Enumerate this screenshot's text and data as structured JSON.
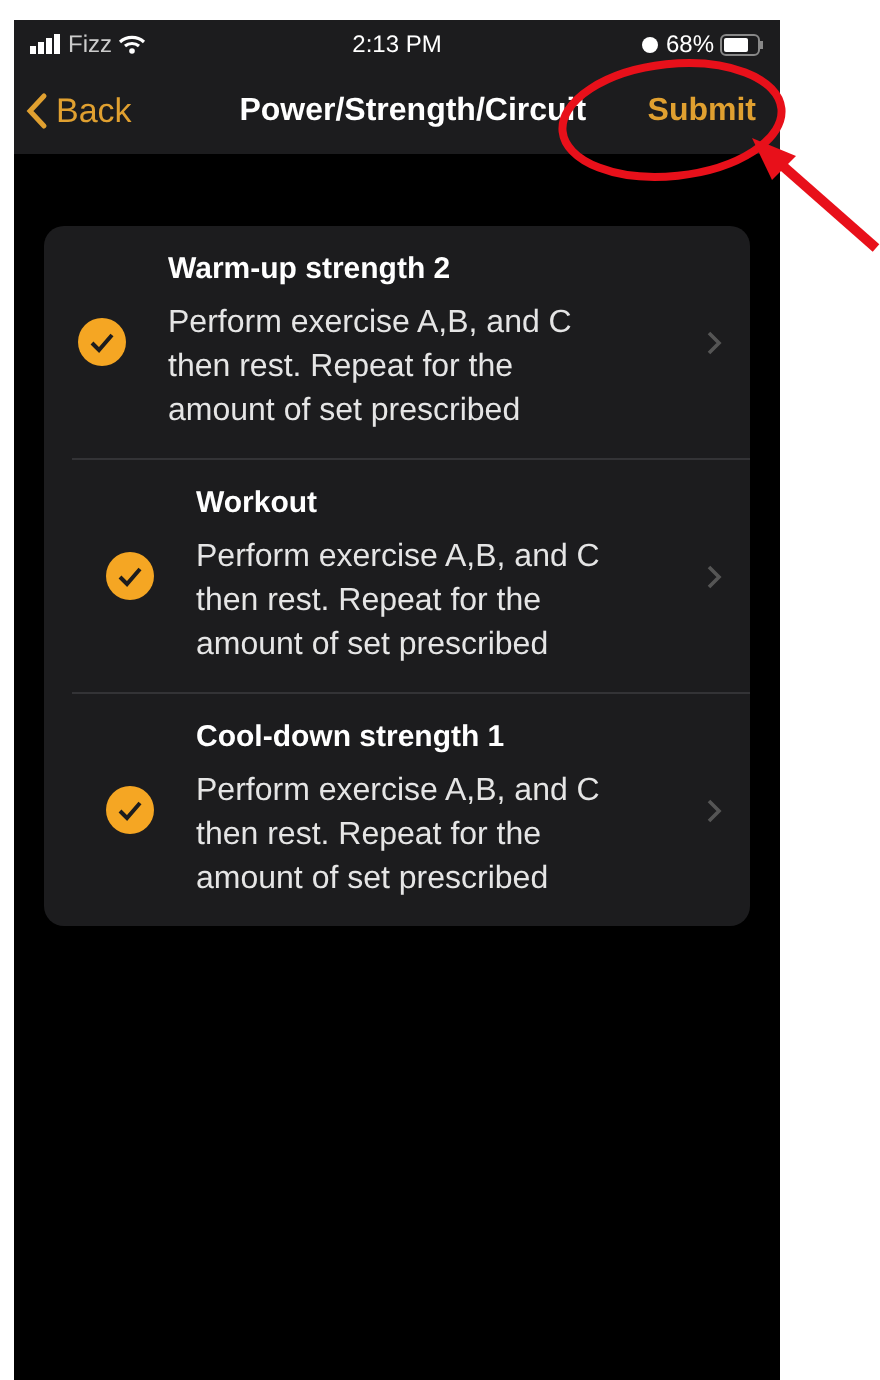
{
  "status_bar": {
    "carrier": "Fizz",
    "time": "2:13 PM",
    "battery": "68%"
  },
  "nav_bar": {
    "back": "Back",
    "title": "Power/Strength/Circuit",
    "action": "Submit"
  },
  "items": [
    {
      "title": "Warm-up strength 2",
      "description": "Perform exercise A,B, and C then rest. Repeat for the amount of set prescribed",
      "checked": true
    },
    {
      "title": "Workout",
      "description": "Perform exercise A,B, and C then rest. Repeat for the amount of set prescribed",
      "checked": true
    },
    {
      "title": "Cool-down strength 1",
      "description": "Perform exercise A,B, and C then rest. Repeat for the amount of set prescribed",
      "checked": true
    }
  ]
}
